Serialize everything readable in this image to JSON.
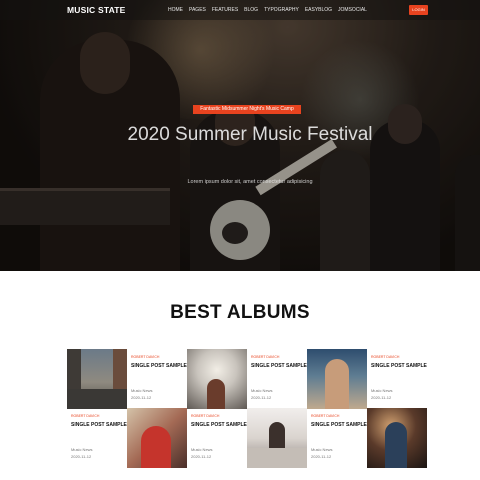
{
  "nav": {
    "brand": "MUSIC STATE",
    "menu": [
      "HOME",
      "PAGES",
      "FEATURES",
      "BLOG",
      "TYPOGRAPHY",
      "EASYBLOG",
      "JOMSOCIAL"
    ],
    "login": "LOGIN"
  },
  "hero": {
    "tag": "Fantastic Midsummer Night's Music Camp",
    "title": "2020 Summer Music Festival",
    "subtitle": "Lorem ipsum dolor sit, amet consectetur adipisicing"
  },
  "albums": {
    "heading": "BEST ALBUMS",
    "items": [
      {
        "author": "ROBERT DAVICH",
        "title": "SINGLE POST SAMPLE",
        "category": "Music News",
        "date": "2020-11-12"
      },
      {
        "author": "ROBERT DAVICH",
        "title": "SINGLE POST SAMPLE",
        "category": "Music News",
        "date": "2020-11-12"
      },
      {
        "author": "ROBERT DAVICH",
        "title": "SINGLE POST SAMPLE",
        "category": "Music News",
        "date": "2020-11-12"
      },
      {
        "author": "ROBERT DAVICH",
        "title": "SINGLE POST SAMPLE",
        "category": "Music News",
        "date": "2020-11-12"
      },
      {
        "author": "ROBERT DAVICH",
        "title": "SINGLE POST SAMPLE",
        "category": "Music News",
        "date": "2020-11-12"
      },
      {
        "author": "ROBERT DAVICH",
        "title": "SINGLE POST SAMPLE",
        "category": "Music News",
        "date": "2020-11-12"
      }
    ]
  },
  "colors": {
    "accent": "#e8431f"
  }
}
